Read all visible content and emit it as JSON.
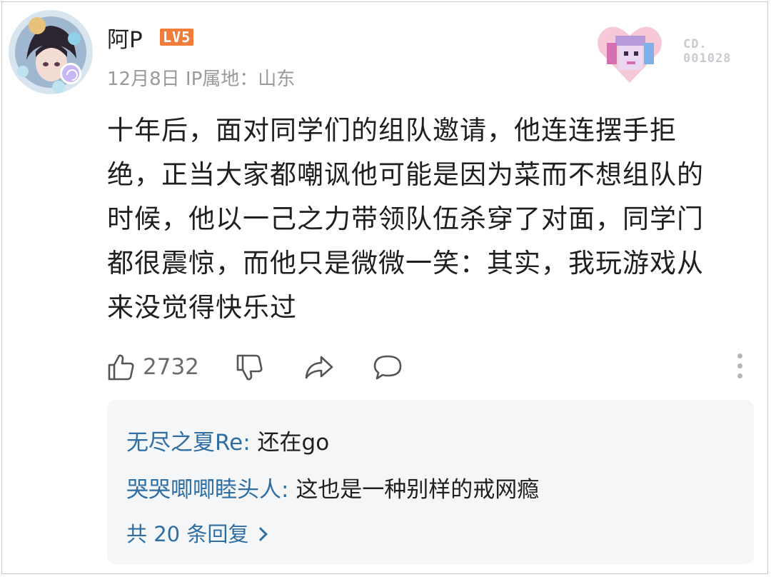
{
  "comment": {
    "username": "阿P",
    "level": "LV5",
    "date": "12月8日",
    "ip_location": "IP属地：山东",
    "deco_text_line1": "CD.",
    "deco_text_line2": "001028",
    "lines": [
      "十年后，面对同学们的组队邀请，他连连摆手拒",
      "绝，正当大家都嘲讽他可能是因为菜而不想组队的",
      "时候，他以一己之力带领队伍杀穿了对面，同学门",
      "都很震惊，而他只是微微一笑：其实，我玩游戏从",
      "来没觉得快乐过"
    ],
    "like_count": "2732"
  },
  "icons": {
    "like": "thumbs-up-icon",
    "dislike": "thumbs-down-icon",
    "share": "share-icon",
    "reply": "comment-bubble-icon",
    "more": "more-vertical-icon"
  },
  "colors": {
    "level_badge": "#f07d3a",
    "reply_name": "#2f6ea3",
    "reply_bg": "#f5f6f7"
  },
  "replies": [
    {
      "user": "无尽之夏",
      "suffix": "Re: ",
      "text": "还在go"
    },
    {
      "user": "哭哭唧唧睦头人",
      "suffix": ": ",
      "text": "这也是一种别样的戒网瘾"
    }
  ],
  "more_replies": "共 20 条回复"
}
